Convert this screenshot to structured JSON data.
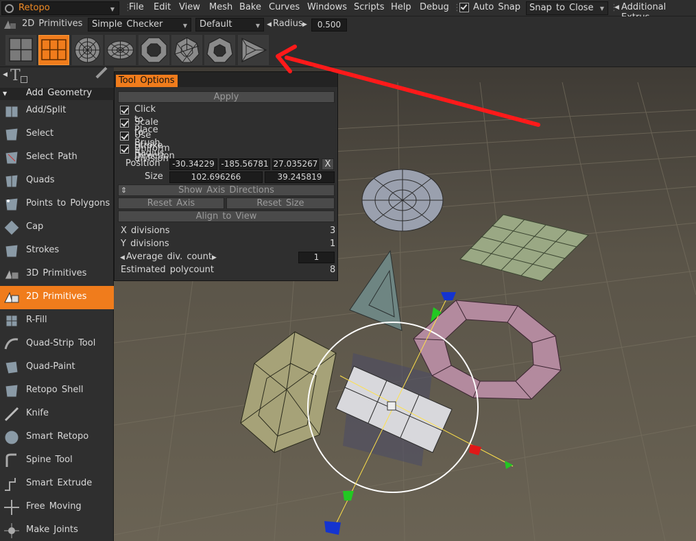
{
  "menu": {
    "room": "Retopo",
    "items": [
      "File",
      "Edit",
      "View",
      "Mesh",
      "Bake",
      "Curves",
      "Windows",
      "Scripts",
      "Help",
      "Debug"
    ],
    "auto_snap": "Auto Snap",
    "snap_to_close": "Snap to Close",
    "additional": "Additional Extrus"
  },
  "toolbar2": {
    "tool": "2D Primitives",
    "checker": "Simple Checker",
    "preset": "Default",
    "radius_label": "Radius",
    "radius_value": "0.500"
  },
  "primitive_icons": [
    "quad-grid-icon",
    "grid-2x3-icon",
    "disc-radial-icon",
    "ellipse-disc-icon",
    "octagon-ring-icon",
    "polygon-disc-icon",
    "heptagon-ring-icon",
    "triangle-icon"
  ],
  "sidebar": {
    "section": "Add Geometry",
    "items": [
      {
        "label": "Add/Split",
        "icon": "add-split-icon"
      },
      {
        "label": "Select",
        "icon": "select-icon"
      },
      {
        "label": "Select Path",
        "icon": "select-path-icon"
      },
      {
        "label": "Quads",
        "icon": "quads-icon"
      },
      {
        "label": "Points to Polygons",
        "icon": "points-to-polygons-icon"
      },
      {
        "label": "Cap",
        "icon": "cap-icon"
      },
      {
        "label": "Strokes",
        "icon": "strokes-icon"
      },
      {
        "label": "3D Primitives",
        "icon": "3d-primitives-icon"
      },
      {
        "label": "2D Primitives",
        "icon": "2d-primitives-icon"
      },
      {
        "label": "R-Fill",
        "icon": "r-fill-icon"
      },
      {
        "label": "Quad-Strip Tool",
        "icon": "quad-strip-icon"
      },
      {
        "label": "Quad-Paint",
        "icon": "quad-paint-icon"
      },
      {
        "label": "Retopo Shell",
        "icon": "retopo-shell-icon"
      },
      {
        "label": "Knife",
        "icon": "knife-icon"
      },
      {
        "label": "Smart Retopo",
        "icon": "smart-retopo-icon"
      },
      {
        "label": "Spine Tool",
        "icon": "spine-tool-icon"
      },
      {
        "label": "Smart Extrude",
        "icon": "smart-extrude-icon"
      },
      {
        "label": "Free Moving",
        "icon": "free-moving-icon"
      },
      {
        "label": "Make Joints",
        "icon": "make-joints-icon"
      }
    ]
  },
  "tool_options": {
    "tab": "Tool Options",
    "apply": "Apply",
    "checks": [
      "Click to Place",
      "Scale to Brush Radius",
      "Use Stroke Direction",
      "Uniform division"
    ],
    "position_label": "Position",
    "position": [
      "-30.34229",
      "-185.56781",
      "27.035267"
    ],
    "position_x_btn": "X",
    "size_label": "Size",
    "size": [
      "102.696266",
      "39.245819"
    ],
    "show_axis": "Show Axis Directions",
    "reset_axis": "Reset Axis",
    "reset_size": "Reset Size",
    "align_view": "Align to View",
    "x_div_label": "X divisions",
    "x_div": "3",
    "y_div_label": "Y divisions",
    "y_div": "1",
    "avg_label": "Average div. count",
    "avg": "1",
    "poly_label": "Estimated polycount",
    "poly": "8"
  },
  "colors": {
    "accent": "#f07c1c",
    "annotation_arrow": "#ff1a1a"
  }
}
